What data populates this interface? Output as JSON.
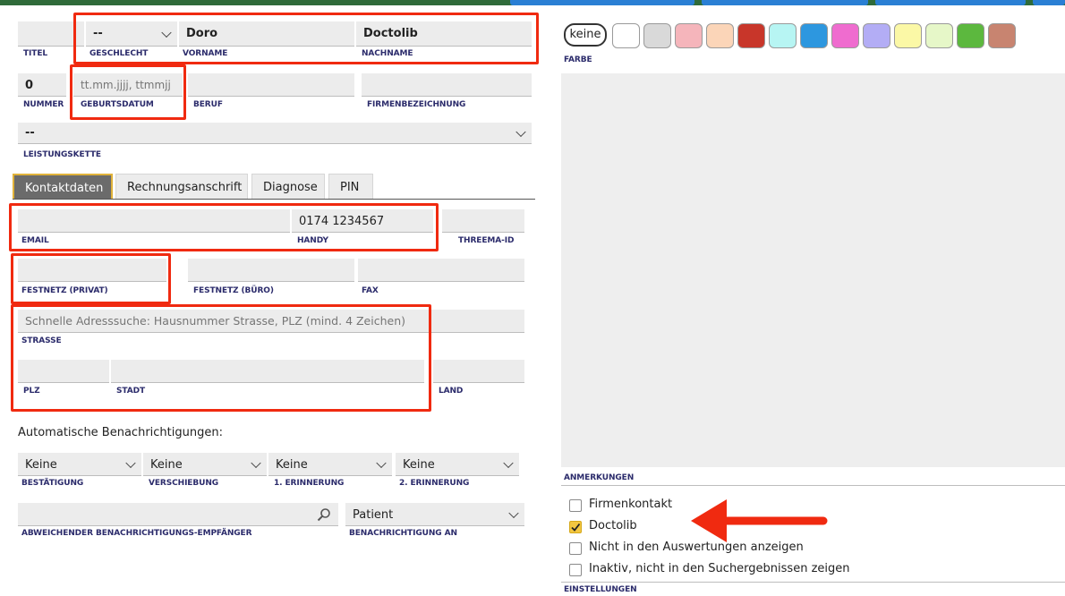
{
  "personal": {
    "titel_label": "TITEL",
    "geschlecht_value": "--",
    "geschlecht_label": "GESCHLECHT",
    "vorname_value": "Doro",
    "vorname_label": "VORNAME",
    "nachname_value": "Doctolib",
    "nachname_label": "NACHNAME",
    "nummer_value": "0",
    "nummer_label": "NUMMER",
    "geburtsdatum_placeholder": "tt.mm.jjjj, ttmmjj",
    "geburtsdatum_label": "GEBURTSDATUM",
    "beruf_label": "BERUF",
    "firmenbezeichnung_label": "FIRMENBEZEICHNUNG",
    "leistungskette_value": "--",
    "leistungskette_label": "LEISTUNGSKETTE"
  },
  "tabs": {
    "kontaktdaten": "Kontaktdaten",
    "rechnungsanschrift": "Rechnungsanschrift",
    "diagnose": "Diagnose",
    "pin": "PIN"
  },
  "contact": {
    "email_label": "EMAIL",
    "handy_value": "0174 1234567",
    "handy_label": "HANDY",
    "threema_label": "THREEMA-ID",
    "festnetz_privat_label": "FESTNETZ (PRIVAT)",
    "festnetz_buero_label": "FESTNETZ (BÜRO)",
    "fax_label": "FAX",
    "strasse_placeholder": "Schnelle Adresssuche: Hausnummer Strasse, PLZ (mind. 4 Zeichen)",
    "strasse_label": "STRASSE",
    "plz_label": "PLZ",
    "stadt_label": "STADT",
    "land_label": "LAND"
  },
  "notifications": {
    "heading": "Automatische Benachrichtigungen:",
    "bestaetigung_value": "Keine",
    "bestaetigung_label": "BESTÄTIGUNG",
    "verschiebung_value": "Keine",
    "verschiebung_label": "VERSCHIEBUNG",
    "erinnerung1_value": "Keine",
    "erinnerung1_label": "1. ERINNERUNG",
    "erinnerung2_value": "Keine",
    "erinnerung2_label": "2. ERINNERUNG",
    "empfaenger_label": "ABWEICHENDER BENACHRICHTIGUNGS-EMPFÄNGER",
    "benachrichtigung_an_value": "Patient",
    "benachrichtigung_an_label": "BENACHRICHTIGUNG AN"
  },
  "color": {
    "keine_label": "keine",
    "farbe_label": "FARBE",
    "swatches": [
      "#ffffff",
      "#d9d9d9",
      "#f5b5bb",
      "#fbd5b8",
      "#c8362a",
      "#b7f5f3",
      "#2d97df",
      "#ef6ccf",
      "#b3adf5",
      "#fbf8a6",
      "#e6f7c8",
      "#5cb83e",
      "#c88470"
    ]
  },
  "notes": {
    "anmerkungen_label": "ANMERKUNGEN"
  },
  "settings": {
    "firmenkontakt_label": "Firmenkontakt",
    "firmenkontakt_checked": false,
    "doctolib_label": "Doctolib",
    "doctolib_checked": true,
    "nicht_auswertung_label": "Nicht in den Auswertungen anzeigen",
    "nicht_auswertung_checked": false,
    "inaktiv_label": "Inaktiv, nicht in den Suchergebnissen zeigen",
    "inaktiv_checked": false,
    "einstellungen_label": "EINSTELLUNGEN"
  },
  "annotation": {
    "highlight_color": "#f02a10"
  },
  "icons": {
    "search": "magnifier-icon",
    "dropdown": "chevron-down-icon",
    "annotation_arrow": "red-arrow-left-icon"
  }
}
